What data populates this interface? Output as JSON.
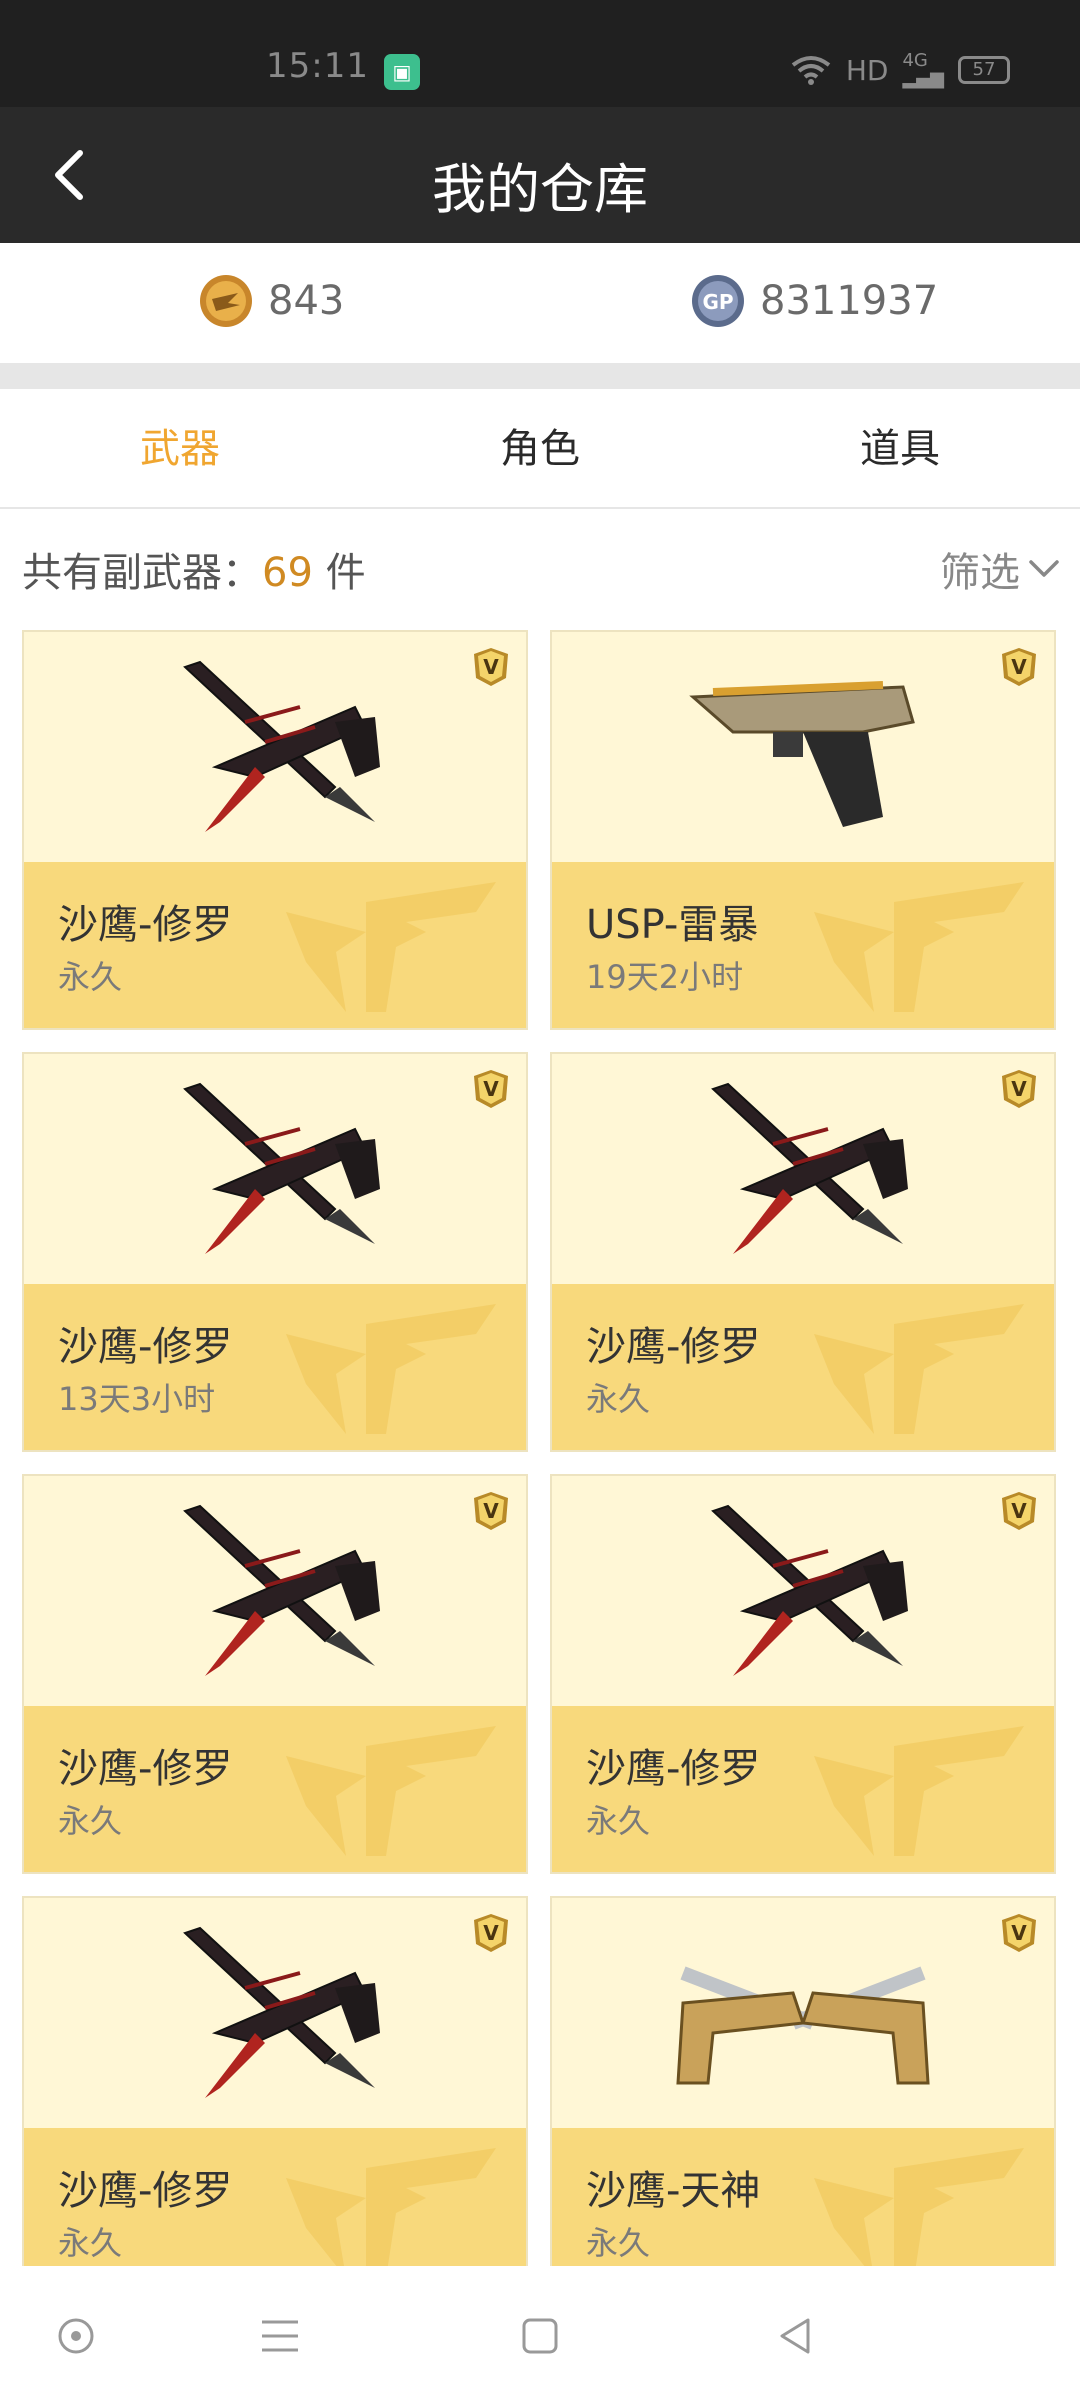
{
  "status": {
    "time": "15:11",
    "network": "HD",
    "signal": "4G",
    "battery": "57"
  },
  "header": {
    "title": "我的仓库"
  },
  "currency": {
    "cf_points": "843",
    "gp_points": "8311937"
  },
  "tabs": [
    {
      "label": "武器",
      "active": true
    },
    {
      "label": "角色",
      "active": false
    },
    {
      "label": "道具",
      "active": false
    }
  ],
  "summary": {
    "prefix": "共有副武器：",
    "count": "69",
    "suffix": " 件",
    "filter_label": "筛选"
  },
  "items": [
    {
      "name": "沙鹰-修罗",
      "duration": "永久",
      "image": "dark-pistol-blade"
    },
    {
      "name": "USP-雷暴",
      "duration": "19天2小时",
      "image": "gold-pistol"
    },
    {
      "name": "沙鹰-修罗",
      "duration": "13天3小时",
      "image": "dark-pistol-blade"
    },
    {
      "name": "沙鹰-修罗",
      "duration": "永久",
      "image": "dark-pistol-blade"
    },
    {
      "name": "沙鹰-修罗",
      "duration": "永久",
      "image": "dark-pistol-blade"
    },
    {
      "name": "沙鹰-修罗",
      "duration": "永久",
      "image": "dark-pistol-blade"
    },
    {
      "name": "沙鹰-修罗",
      "duration": "永久",
      "image": "dark-pistol-blade"
    },
    {
      "name": "沙鹰-天神",
      "duration": "永久",
      "image": "gold-dual-pistol"
    }
  ],
  "colors": {
    "accent": "#f0a630",
    "card_top": "#fff7d6",
    "card_bottom": "#f8d97c",
    "header": "#2a2a2a"
  }
}
